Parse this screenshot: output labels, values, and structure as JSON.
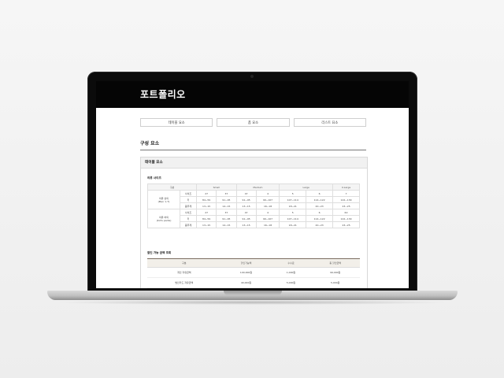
{
  "site": {
    "title": "포트폴리오"
  },
  "tabs": [
    "테이블 요소",
    "폼 요소",
    "리스트 요소"
  ],
  "section": {
    "title": "구성 요소"
  },
  "panel": {
    "header": "테이블 요소",
    "size_table": {
      "title": "의류 사이즈",
      "columns": [
        "구분",
        "",
        "Small",
        "",
        "Medium",
        "",
        "Large",
        "",
        "X-Large"
      ],
      "groups": [
        {
          "label_line1": "의류 상의",
          "label_line2": "(Men 's T)",
          "rows": [
            {
              "metric": "사이즈",
              "values": [
                "27",
                "37",
                "47",
                "4",
                "5",
                "6",
                "7"
              ]
            },
            {
              "metric": "키",
              "values": [
                "84~59",
                "91~95",
                "91~95",
                "99~107",
                "107~114",
                "114~122",
                "122~130"
              ]
            },
            {
              "metric": "몸무게",
              "values": [
                "13~15",
                "14~15",
                "13~15",
                "16~18",
                "18~21",
                "20~23",
                "23~25"
              ]
            }
          ]
        },
        {
          "label_line1": "의류 하의",
          "label_line2": "(Kid's pants)",
          "rows": [
            {
              "metric": "사이즈",
              "values": [
                "27",
                "37",
                "47",
                "4",
                "5",
                "6",
                "6X"
              ]
            },
            {
              "metric": "키",
              "values": [
                "84~59",
                "91~95",
                "91~95",
                "99~107",
                "107~114",
                "114~122",
                "122~130"
              ]
            },
            {
              "metric": "몸무게",
              "values": [
                "13~15",
                "14~15",
                "13~15",
                "16~18",
                "18~21",
                "20~23",
                "23~25"
              ]
            }
          ]
        }
      ]
    },
    "rent_table": {
      "title": "할인 가능 금액 조회",
      "columns": [
        "구분",
        "할인가능액",
        "수수료",
        "총 할인금액"
      ],
      "rows": [
        [
          "개인 자유금액",
          "100,000원",
          "1,000원",
          "99,000원"
        ],
        [
          "법인카드 자유금액",
          "40,000원",
          "5,000원",
          "5,000원"
        ]
      ]
    }
  }
}
